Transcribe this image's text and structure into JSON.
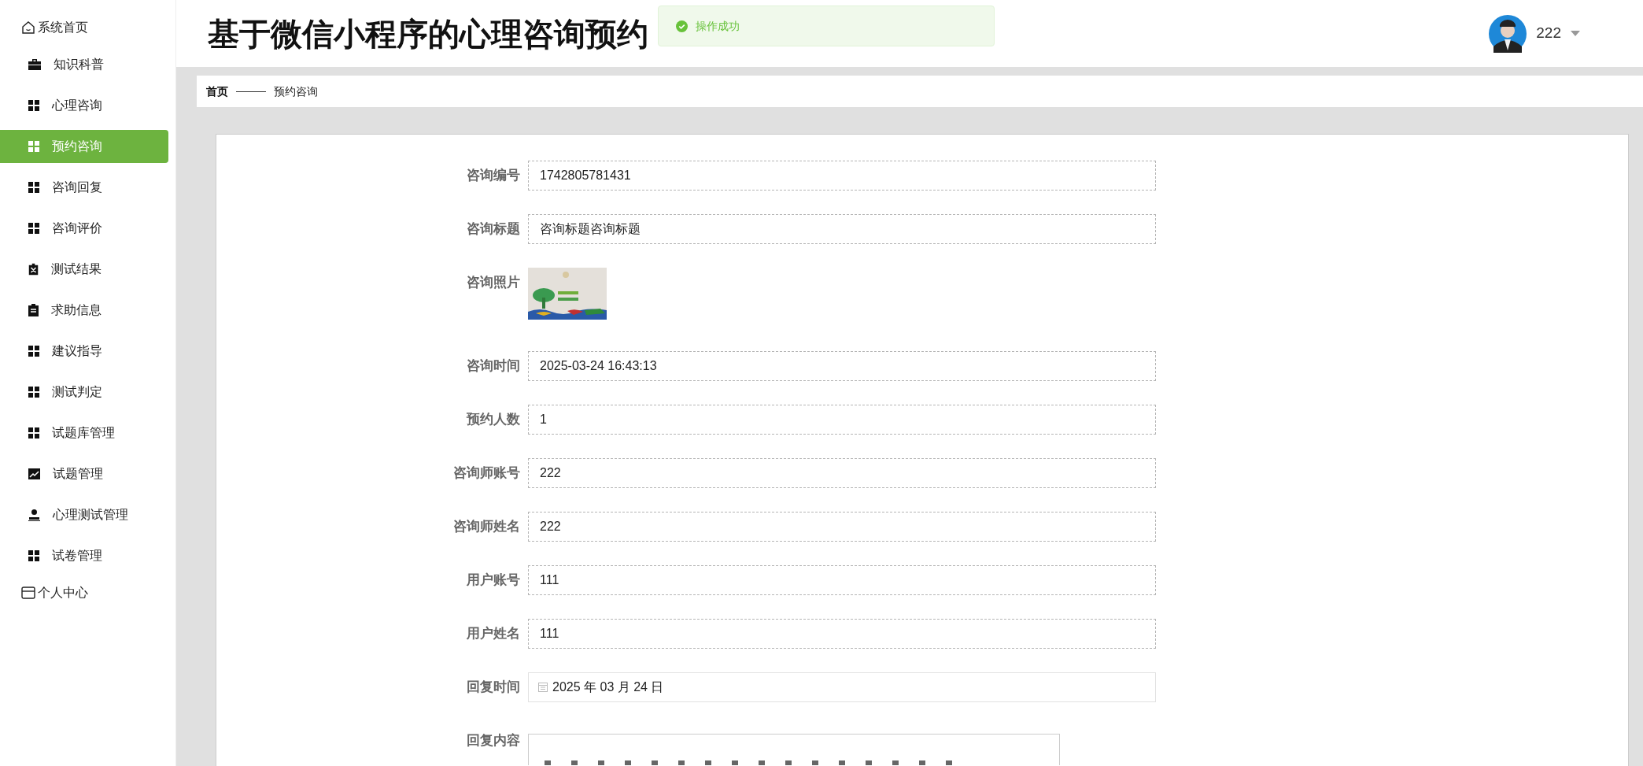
{
  "sidebar": {
    "items": [
      {
        "label": "系统首页",
        "selected": false,
        "children": [
          {
            "label": "知识科普",
            "selected": false
          },
          {
            "label": "心理咨询",
            "selected": false
          },
          {
            "label": "预约咨询",
            "selected": true
          },
          {
            "label": "咨询回复",
            "selected": false
          },
          {
            "label": "咨询评价",
            "selected": false
          },
          {
            "label": "测试结果",
            "selected": false
          },
          {
            "label": "求助信息",
            "selected": false
          },
          {
            "label": "建议指导",
            "selected": false
          },
          {
            "label": "测试判定",
            "selected": false
          },
          {
            "label": "试题库管理",
            "selected": false
          },
          {
            "label": "试题管理",
            "selected": false
          },
          {
            "label": "心理测试管理",
            "selected": false
          },
          {
            "label": "试卷管理",
            "selected": false
          }
        ]
      },
      {
        "label": "个人中心",
        "selected": false
      }
    ]
  },
  "header": {
    "title": "基于微信小程序的心理咨询预约",
    "user": "222"
  },
  "toast": {
    "message": "操作成功"
  },
  "breadcrumb": [
    "首页",
    "预约咨询"
  ],
  "form": {
    "fields": [
      {
        "label": "咨询编号",
        "kind": "text",
        "value": "1742805781431"
      },
      {
        "label": "咨询标题",
        "kind": "text",
        "value": "咨询标题咨询标题"
      },
      {
        "label": "咨询照片"
      },
      {
        "label": "咨询时间",
        "kind": "text",
        "value": "2025-03-24 16:43:13"
      },
      {
        "label": "预约人数",
        "kind": "text",
        "value": "1"
      },
      {
        "label": "咨询师账号",
        "kind": "text",
        "value": "222"
      },
      {
        "label": "咨询师姓名",
        "kind": "text",
        "value": "222"
      },
      {
        "label": "用户账号",
        "kind": "text",
        "value": "111"
      },
      {
        "label": "用户姓名",
        "kind": "text",
        "value": "111"
      },
      {
        "label": "回复时间",
        "kind": "date",
        "value": "2025 年 03 月 24 日"
      },
      {
        "label": "回复内容",
        "kind": "editor"
      }
    ]
  }
}
